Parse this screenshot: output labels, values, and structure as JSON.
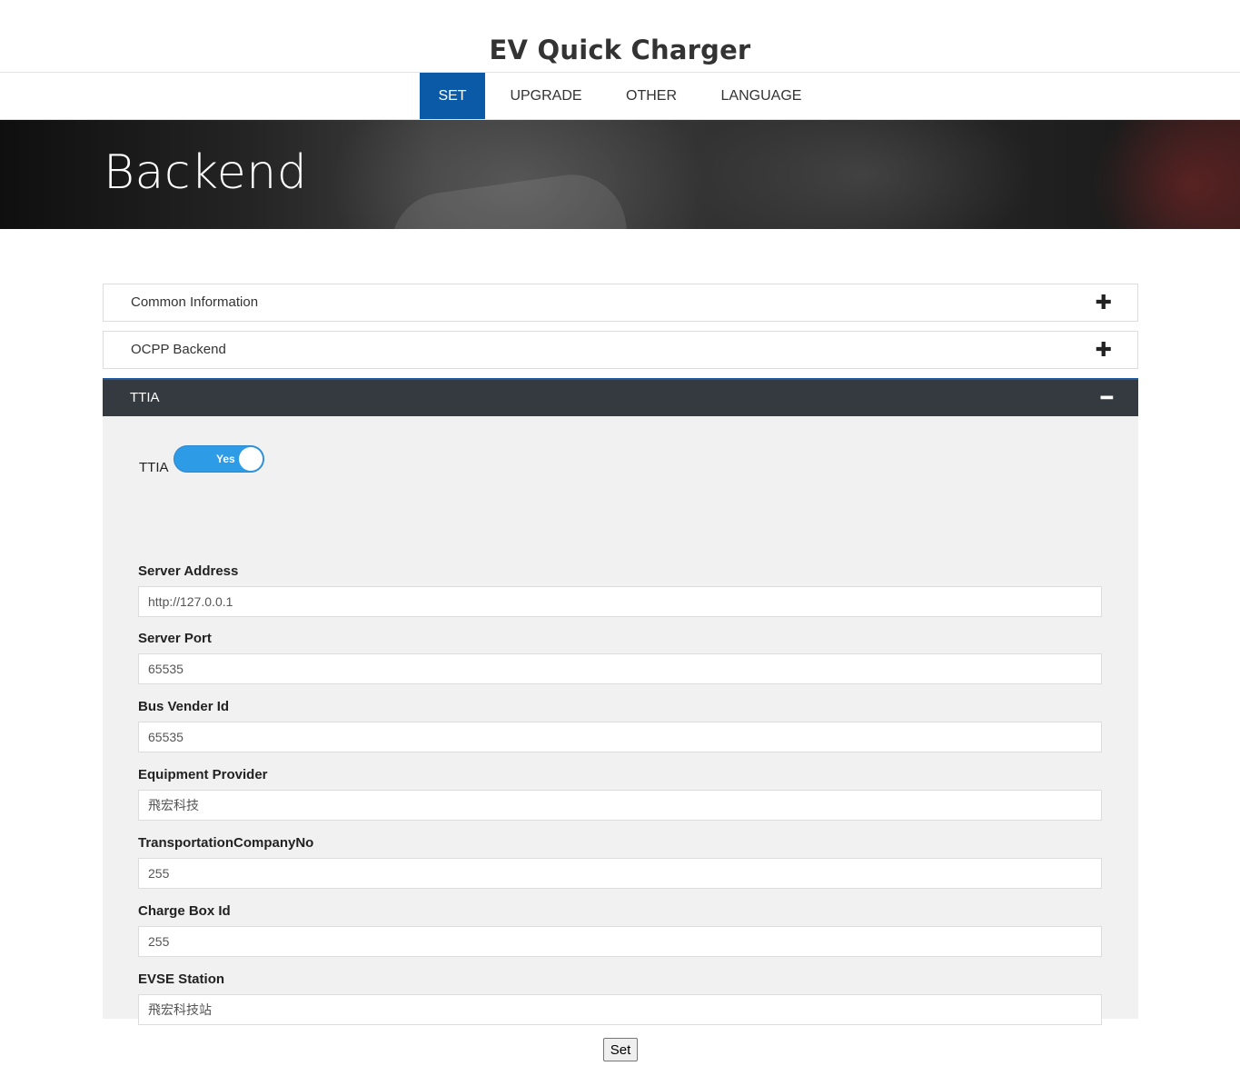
{
  "header": {
    "title": "EV Quick Charger"
  },
  "nav": {
    "items": [
      {
        "label": "SET"
      },
      {
        "label": "UPGRADE"
      },
      {
        "label": "OTHER"
      },
      {
        "label": "LANGUAGE"
      }
    ],
    "active": "SET"
  },
  "hero": {
    "title": "Backend"
  },
  "accordion": {
    "sections": [
      {
        "label": "Common Information",
        "icon": "plus-icon"
      },
      {
        "label": "OCPP Backend",
        "icon": "plus-icon"
      },
      {
        "label": "TTIA",
        "icon": "minus-icon"
      }
    ],
    "ttia": {
      "toggle_label": "TTIA",
      "toggle_value": "Yes",
      "fields": [
        {
          "label": "Server Address",
          "value": "http://127.0.0.1"
        },
        {
          "label": "Server Port",
          "value": "65535"
        },
        {
          "label": "Bus Vender Id",
          "value": "65535"
        },
        {
          "label": "Equipment Provider",
          "value": "飛宏科技"
        },
        {
          "label": "TransportationCompanyNo",
          "value": "255"
        },
        {
          "label": "Charge Box Id",
          "value": "255"
        },
        {
          "label": "EVSE Station",
          "value": "飛宏科技站"
        }
      ]
    }
  },
  "actions": {
    "set_label": "Set"
  },
  "colors": {
    "nav_active": "#0a5aa8",
    "accordion_active": "#343a40",
    "toggle_on": "#2e9be6",
    "panel_bg": "#f1f1f1"
  }
}
